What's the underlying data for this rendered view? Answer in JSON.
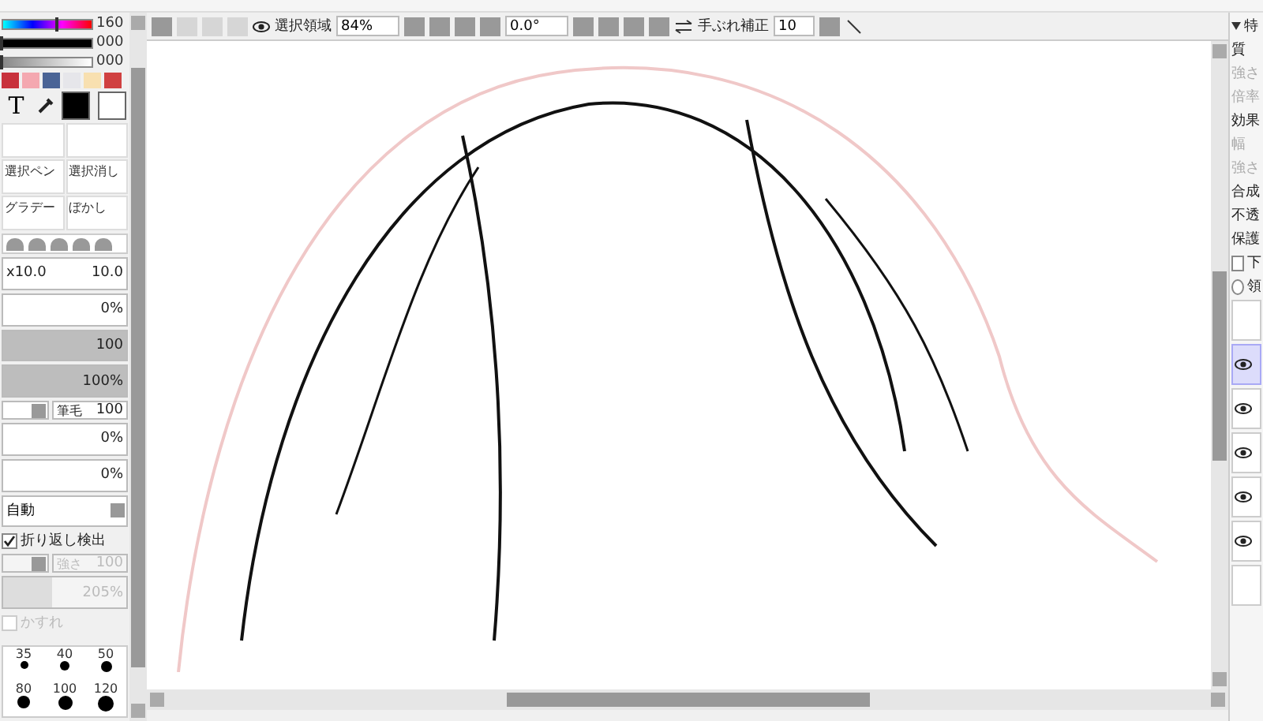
{
  "color_sliders": [
    {
      "kind": "hue",
      "reading": "160",
      "level": 0.63
    },
    {
      "kind": "dark",
      "reading": "000",
      "level": 0
    },
    {
      "kind": "light",
      "reading": "000",
      "level": 0
    }
  ],
  "swatches": [
    {
      "color": "#c8323c"
    },
    {
      "color": "#f4a8b0"
    },
    {
      "color": "#4a6496"
    },
    {
      "color": "#e6e6ea"
    },
    {
      "color": "#f8e0b0"
    },
    {
      "color": "#d04040"
    }
  ],
  "tools": {
    "text_tool": "T"
  },
  "brushes": [
    {
      "selected": false
    },
    {
      "selected": false
    },
    {
      "label": "選択ペン",
      "selected": false
    },
    {
      "label": "選択消し",
      "selected": false
    },
    {
      "label": "グラデー",
      "selected": false
    },
    {
      "label": "ぼかし",
      "selected": false
    }
  ],
  "brush_settings": {
    "size_prefix": "x10.0",
    "size": "10.0",
    "min_size": "0%",
    "density": {
      "reading": "100",
      "level": 1
    },
    "opacity": {
      "reading": "100%",
      "level": 1
    },
    "bristle": {
      "label": "筆毛",
      "reading": "100"
    },
    "field_a": "0%",
    "field_b": "0%",
    "mode": "自動",
    "wrap_detect": {
      "label": "折り返し検出",
      "checked": true
    },
    "strength": {
      "label": "強さ",
      "reading": "100",
      "disabled": true
    },
    "texture": {
      "reading": "205%",
      "level": 0.4,
      "disabled": true
    },
    "blur": {
      "label": "かすれ",
      "checked": false,
      "disabled": true
    }
  },
  "brush_sizes": [
    {
      "label": "35"
    },
    {
      "label": "40"
    },
    {
      "label": "50"
    },
    {
      "label": "80"
    },
    {
      "label": "100"
    },
    {
      "label": "120"
    }
  ],
  "toolbar": {
    "selection_label": "選択領域",
    "zoom": "84%",
    "rotation": "0.0°",
    "stabilizer_label": "手ぶれ補正",
    "stabilizer": "10"
  },
  "right_panel": {
    "header": "特",
    "texture_title": "質",
    "texture_rows": [
      "強さ",
      "倍率"
    ],
    "effect_title": "効果",
    "effect_rows": [
      "幅",
      "強さ"
    ],
    "blend": "合成",
    "opacity": "不透",
    "protect": "保護",
    "clip": {
      "label": "下",
      "checked": false
    },
    "selection_source": {
      "label": "領",
      "selected": false
    }
  },
  "layers": [
    {
      "visible": false,
      "selected": false
    },
    {
      "visible": true,
      "selected": true
    },
    {
      "visible": true,
      "selected": false
    },
    {
      "visible": true,
      "selected": false
    },
    {
      "visible": true,
      "selected": false
    },
    {
      "visible": true,
      "selected": false
    },
    {
      "visible": false,
      "selected": false
    }
  ]
}
